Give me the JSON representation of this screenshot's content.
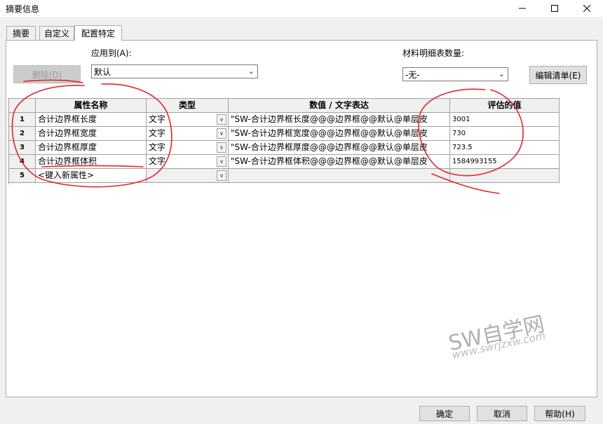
{
  "window": {
    "title": "摘要信息"
  },
  "tabs": [
    {
      "label": "摘要"
    },
    {
      "label": "自定义"
    },
    {
      "label": "配置特定"
    }
  ],
  "apply_to": {
    "label": "应用到(A):",
    "value": "默认"
  },
  "delete_button": {
    "label": "删除(D)"
  },
  "bom_qty": {
    "label": "材料明细表数量:",
    "value": "-无-"
  },
  "edit_list_button": {
    "label": "编辑清单(E)"
  },
  "table": {
    "headers": {
      "name": "属性名称",
      "type": "类型",
      "value": "数值 / 文字表达",
      "evaluated": "评估的值"
    },
    "rows": [
      {
        "num": "1",
        "name": "合计边界框长度",
        "type": "文字",
        "value": "\"SW-合计边界框长度@@@边界框@@默认@单层皮",
        "evaluated": "3001"
      },
      {
        "num": "2",
        "name": "合计边界框宽度",
        "type": "文字",
        "value": "\"SW-合计边界框宽度@@@边界框@@默认@单层皮",
        "evaluated": "730"
      },
      {
        "num": "3",
        "name": "合计边界框厚度",
        "type": "文字",
        "value": "\"SW-合计边界框厚度@@@边界框@@默认@单层皮",
        "evaluated": "723.5"
      },
      {
        "num": "4",
        "name": "合计边界框体积",
        "type": "文字",
        "value": "\"SW-合计边界框体积@@@边界框@@默认@单层皮",
        "evaluated": "1584993155"
      },
      {
        "num": "5",
        "name": "<键入新属性>",
        "type": "",
        "value": "",
        "evaluated": ""
      }
    ]
  },
  "watermark": {
    "text": "SW自学网",
    "url": "www.swrjzxw.com"
  },
  "footer": {
    "ok": "确定",
    "cancel": "取消",
    "help": "帮助(H)"
  },
  "annotation_color": "#e0262a"
}
